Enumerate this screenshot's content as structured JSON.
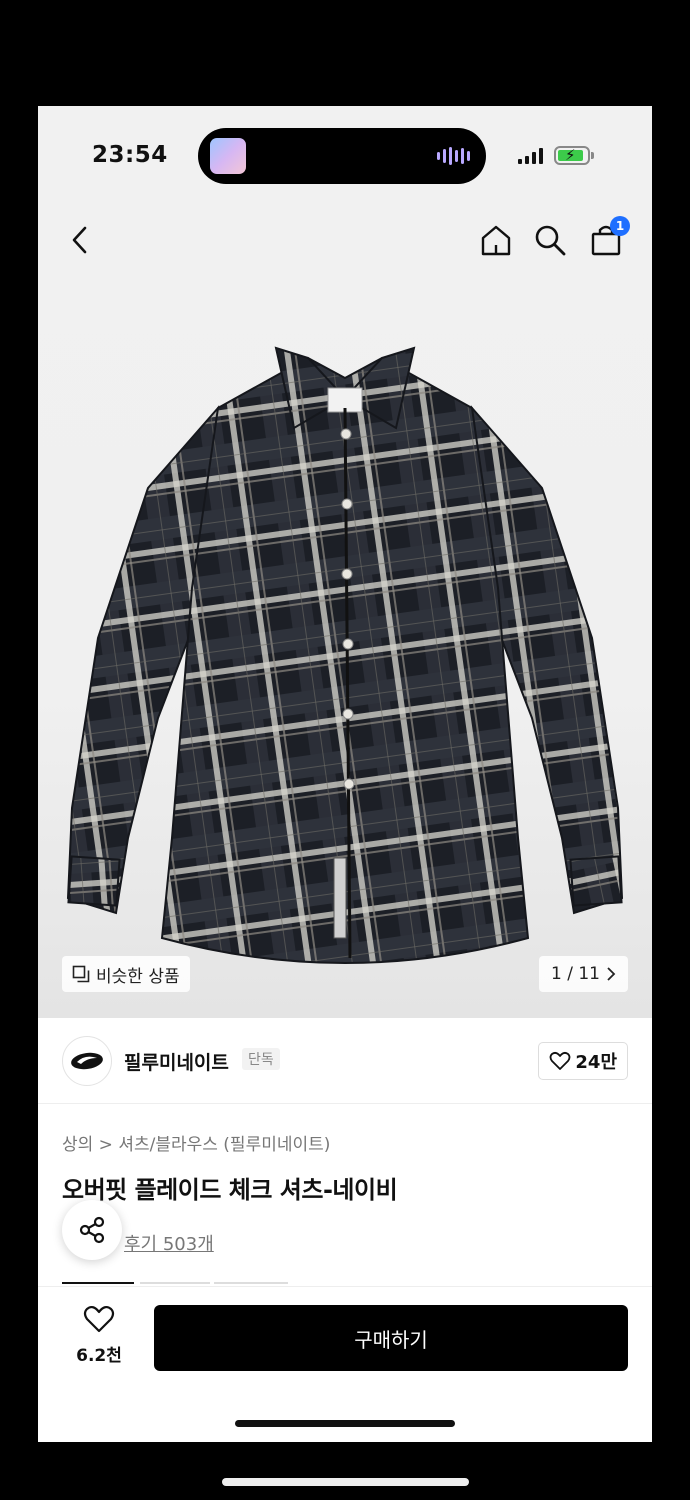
{
  "status_bar": {
    "time": "23:54"
  },
  "navbar": {
    "cart_badge": "1"
  },
  "gallery": {
    "similar_label": "비슷한 상품",
    "pager": "1 / 11"
  },
  "brand": {
    "name": "필루미네이트",
    "tag": "단독",
    "likes": "24만"
  },
  "product": {
    "breadcrumb": "상의 > 셔츠/블라우스 (필루미네이트)",
    "title": "오버핏 플레이드 체크 셔츠-네이비",
    "reviews": "후기 503개"
  },
  "bottom_bar": {
    "wish_count": "6.2천",
    "buy_label": "구매하기"
  },
  "colors": {
    "accent_badge": "#1f6fff",
    "buy_button": "#000000",
    "battery": "#3ccb4a"
  },
  "icons": {
    "back": "chevron-left-icon",
    "home": "home-icon",
    "search": "search-icon",
    "cart": "shopping-bag-icon",
    "similar": "copy-icon",
    "pager_next": "chevron-right-icon",
    "like": "heart-icon",
    "share": "share-icon"
  }
}
